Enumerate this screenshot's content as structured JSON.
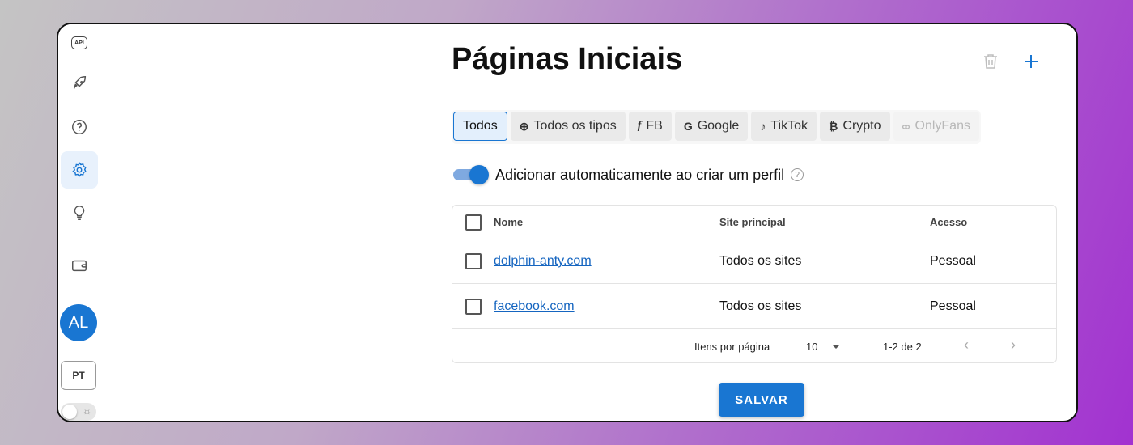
{
  "sidebar": {
    "api_label": "API",
    "icons": [
      "api-icon",
      "rocket-icon",
      "help-icon",
      "settings-icon",
      "lightbulb-icon",
      "wallet-icon"
    ],
    "active": "settings-icon",
    "avatar_initials": "AL",
    "language": "PT"
  },
  "header": {
    "title": "Páginas Iniciais"
  },
  "filters": [
    {
      "label": "Todos",
      "icon": "",
      "state": "active"
    },
    {
      "label": "Todos os tipos",
      "icon": "globe-icon",
      "state": "normal"
    },
    {
      "label": "FB",
      "icon": "facebook-icon",
      "state": "normal"
    },
    {
      "label": "Google",
      "icon": "google-icon",
      "state": "normal"
    },
    {
      "label": "TikTok",
      "icon": "tiktok-icon",
      "state": "normal"
    },
    {
      "label": "Crypto",
      "icon": "bitcoin-icon",
      "state": "normal"
    },
    {
      "label": "OnlyFans",
      "icon": "onlyfans-icon",
      "state": "disabled"
    }
  ],
  "auto_add": {
    "label": "Adicionar automaticamente ao criar um perfil",
    "enabled": true
  },
  "table": {
    "columns": {
      "name": "Nome",
      "site": "Site principal",
      "access": "Acesso"
    },
    "rows": [
      {
        "name": "dolphin-anty.com",
        "site": "Todos os sites",
        "access": "Pessoal"
      },
      {
        "name": "facebook.com",
        "site": "Todos os sites",
        "access": "Pessoal"
      }
    ],
    "pagination": {
      "per_page_label": "Itens por página",
      "per_page": "10",
      "range": "1-2 de 2"
    }
  },
  "actions": {
    "save_label": "SALVAR"
  },
  "colors": {
    "accent": "#1976d2",
    "link": "#1565c0"
  }
}
